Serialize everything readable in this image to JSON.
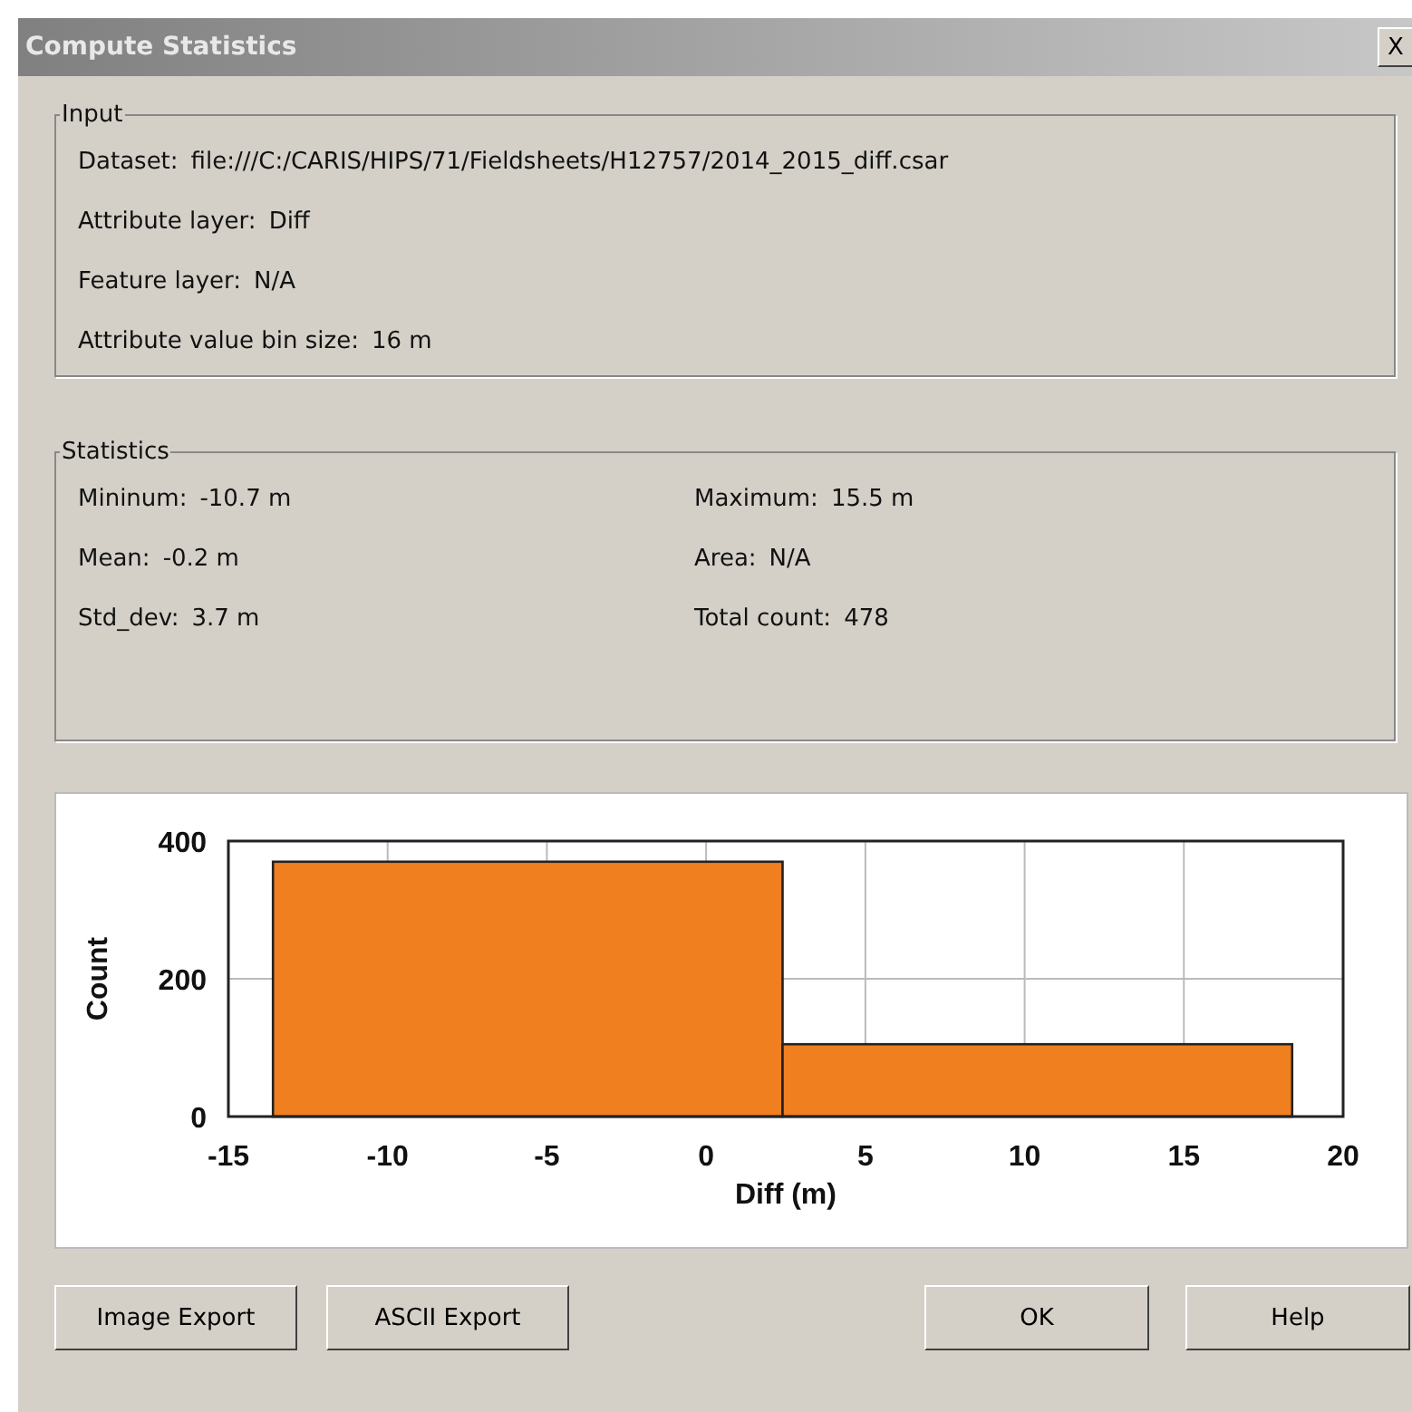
{
  "window": {
    "title": "Compute Statistics",
    "close": "X"
  },
  "input": {
    "legend": "Input",
    "rows": [
      {
        "label": "Dataset:",
        "value": "file:///C:/CARIS/HIPS/71/Fieldsheets/H12757/2014_2015_diff.csar"
      },
      {
        "label": "Attribute layer:",
        "value": "Diff"
      },
      {
        "label": "Feature layer:",
        "value": "N/A"
      },
      {
        "label": "Attribute value bin size:",
        "value": "16 m"
      }
    ]
  },
  "statistics": {
    "legend": "Statistics",
    "items": [
      {
        "label": "Mininum:",
        "value": "-10.7 m"
      },
      {
        "label": "Maximum:",
        "value": "15.5 m"
      },
      {
        "label": "Mean:",
        "value": "-0.2 m"
      },
      {
        "label": "Area:",
        "value": "N/A"
      },
      {
        "label": "Std_dev:",
        "value": "3.7 m"
      },
      {
        "label": "Total count:",
        "value": "478"
      }
    ]
  },
  "chart_data": {
    "type": "bar",
    "xlabel": "Diff (m)",
    "ylabel": "Count",
    "x": [
      -5.6,
      10.4
    ],
    "series": [
      {
        "color": "#f07f1f",
        "values": [
          370,
          105
        ]
      }
    ],
    "grid": true,
    "xlim": [
      -15,
      20
    ],
    "ylim": [
      0,
      400
    ],
    "xticks": [
      -15,
      -10,
      -5,
      0,
      5,
      10,
      15,
      20
    ],
    "yticks": [
      0,
      200,
      400
    ]
  },
  "buttons": [
    {
      "label": "Image Export"
    },
    {
      "label": "ASCII Export"
    },
    {
      "label": "OK"
    },
    {
      "label": "Help"
    }
  ]
}
